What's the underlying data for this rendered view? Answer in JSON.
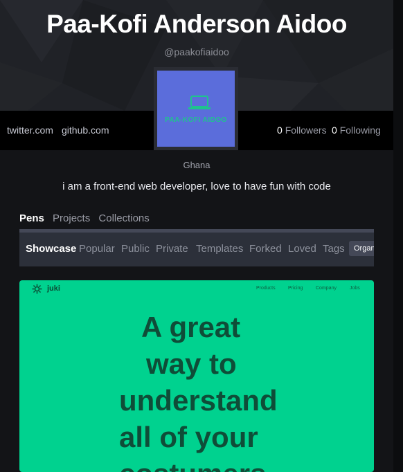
{
  "profile": {
    "name": "Paa-Kofi Anderson Aidoo",
    "handle": "@paakofiaidoo",
    "avatar_text": "PAA-KOFI AIDOO",
    "location": "Ghana",
    "bio": "i am a front-end web developer, love to have fun with code"
  },
  "links": [
    "twitter.com",
    "github.com"
  ],
  "stats": {
    "followers_count": "0",
    "followers_label": "Followers",
    "following_count": "0",
    "following_label": "Following"
  },
  "tabs": [
    {
      "label": "Pens",
      "active": true
    },
    {
      "label": "Projects",
      "active": false
    },
    {
      "label": "Collections",
      "active": false
    }
  ],
  "subnav": {
    "items": [
      "Showcase",
      "Popular",
      "Public",
      "Private",
      "Templates",
      "Forked",
      "Loved",
      "Tags"
    ],
    "active": "Showcase",
    "org_button": "Organize"
  },
  "card": {
    "brand": "juki",
    "nav": [
      "Products",
      "Pricing",
      "Company",
      "Jobs"
    ],
    "headline": [
      "A great",
      "way to",
      "understand",
      "all of your",
      "costumers"
    ]
  },
  "colors": {
    "page_bg": "#131417",
    "card_bg": "#00d28f",
    "avatar_bg": "#5b6ddb"
  }
}
